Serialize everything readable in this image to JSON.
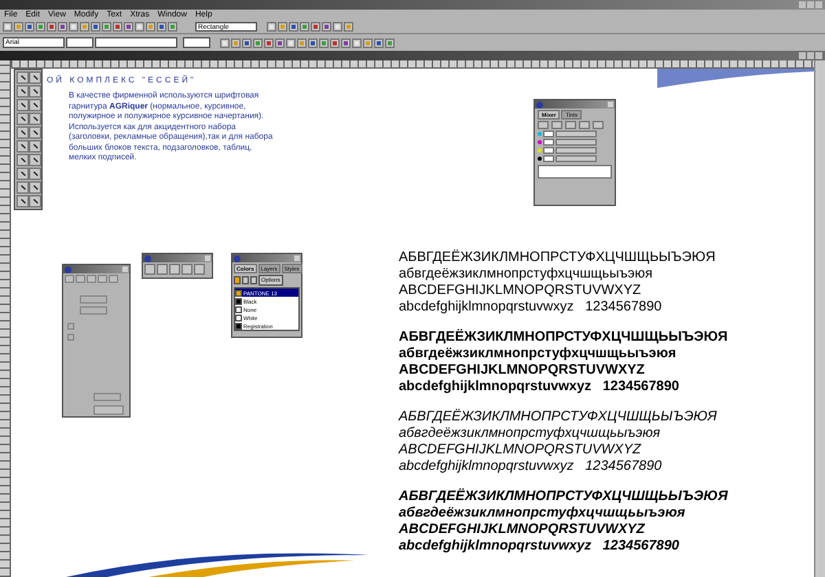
{
  "menu": [
    "File",
    "Edit",
    "View",
    "Modify",
    "Text",
    "Xtras",
    "Window",
    "Help"
  ],
  "toolbar": {
    "object_type": "Rectangle",
    "font": "Arial"
  },
  "document": {
    "heading": "ОЙ КОМПЛЕКС \"ЕССЕЙ\"",
    "paragraph": "В качестве фирменной используются шрифтовая гарнитура **AGRiquer** (нормальное, курсивное, полужирное и полужирное курсивное начертания). Используется как для акцидентного набора (заголовки, рекламные обращения),так и для набора больших блоков текста, подзаголовков, таблиц, мелких подписей."
  },
  "inspector": {
    "checkboxes": [
      {
        "checked": false
      },
      {
        "checked": false
      }
    ]
  },
  "mixer": {
    "tabs": [
      {
        "label": "Mixer",
        "selected": true
      },
      {
        "label": "Tints",
        "selected": false
      }
    ]
  },
  "colors_panel": {
    "tabs": [
      {
        "label": "Colors",
        "selected": true
      },
      {
        "label": "Layers",
        "selected": false
      },
      {
        "label": "Styles",
        "selected": false
      }
    ],
    "options": "Options",
    "items": [
      {
        "name": "PANTONE 13",
        "color": "#f0a000",
        "selected": true
      },
      {
        "name": "Black",
        "color": "#000000",
        "selected": false
      },
      {
        "name": "None",
        "color": "#ffffff",
        "selected": false
      },
      {
        "name": "White",
        "color": "#ffffff",
        "selected": false
      },
      {
        "name": "Registration",
        "color": "#000000",
        "selected": false
      }
    ]
  },
  "specimens": [
    {
      "kind": "regular",
      "lines": [
        "АБВГДЕЁЖЗИКЛМНОПРСТУФХЦЧШЩЬЫЪЭЮЯ",
        "абвгдеёжзиклмнопрстуфхцчшщьыъэюя",
        "ABCDEFGHIJKLMNOPQRSTUVWXYZ",
        "abcdefghijklmnopqrstuvwxyz   1234567890"
      ]
    },
    {
      "kind": "bold",
      "lines": [
        "АБВГДЕЁЖЗИКЛМНОПРСТУФХЦЧШЩЬЫЪЭЮЯ",
        "абвгдеёжзиклмнопрстуфхцчшщьыъэюя",
        "ABCDEFGHIJKLMNOPQRSTUVWXYZ",
        "abcdefghijklmnopqrstuvwxyz   1234567890"
      ]
    },
    {
      "kind": "italic",
      "lines": [
        "АБВГДЕЁЖЗИКЛМНОПРСТУФХЦЧШЩЬЫЪЭЮЯ",
        "абвгдеёжзиклмнопрстуфхцчшщьыъэюя",
        "ABCDEFGHIJKLMNOPQRSTUVWXYZ",
        "abcdefghijklmnopqrstuvwxyz   1234567890"
      ]
    },
    {
      "kind": "bold-italic",
      "lines": [
        "АБВГДЕЁЖЗИКЛМНОПРСТУФХЦЧШЩЬЫЪЭЮЯ",
        "абвгдеёжзиклмнопрстуфхцчшщьыъэюя",
        "ABCDEFGHIJKLMNOPQRSTUVWXYZ",
        "abcdefghijklmnopqrstuvwxyz   1234567890"
      ]
    }
  ]
}
